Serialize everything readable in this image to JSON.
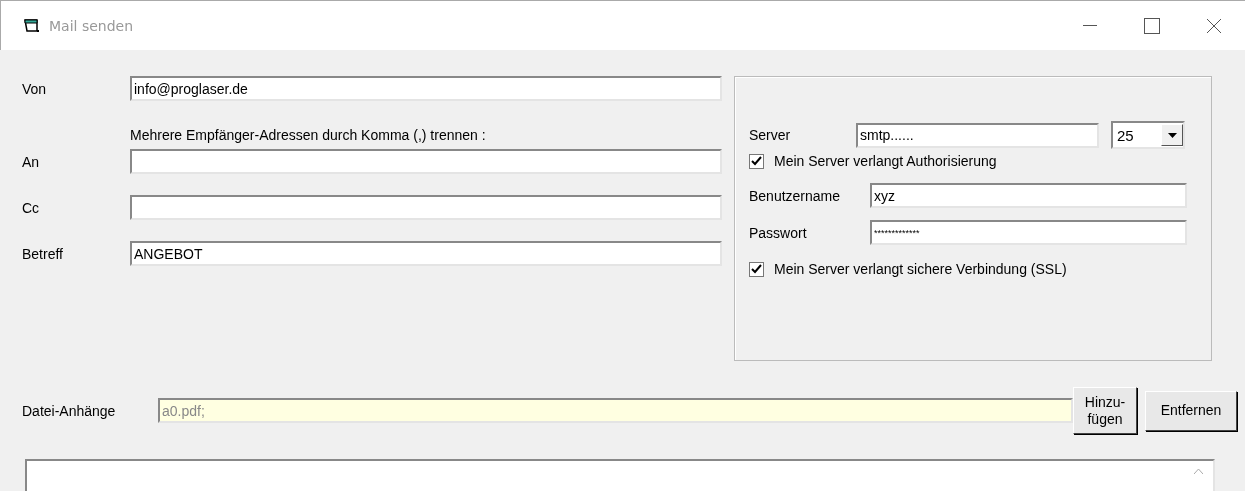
{
  "window": {
    "title": "Mail senden"
  },
  "fields": [
    {
      "label": "Von",
      "value": "info@proglaser.de"
    },
    {
      "label": "An",
      "hint": "Mehrere Empfänger-Adressen durch Komma (,) trennen :"
    },
    {
      "label": "Cc"
    },
    {
      "label": "Betreff",
      "value": "ANGEBOT"
    }
  ],
  "server": {
    "label": "Server",
    "value": "smtp......",
    "port": "25",
    "auth": {
      "label": "Mein Server verlangt Authorisierung",
      "checked": true
    },
    "username": {
      "label": "Benutzername",
      "value": "xyz"
    },
    "password": {
      "label": "Passwort",
      "value": "*************"
    },
    "ssl": {
      "label": "Mein Server verlangt sichere Verbindung (SSL)",
      "checked": true
    }
  },
  "attachments": {
    "label": "Datei-Anhänge",
    "value": "a0.pdf;",
    "buttons": [
      "Hinzu-\nfügen",
      "Entfernen"
    ]
  }
}
